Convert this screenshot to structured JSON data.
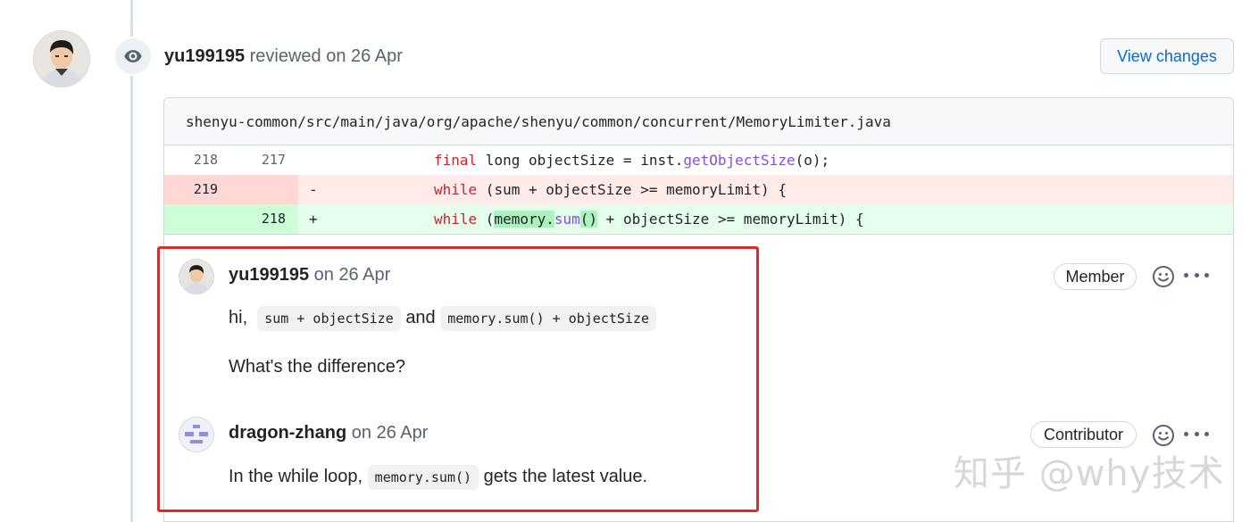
{
  "review": {
    "author": "yu199195",
    "action": " reviewed on 26 Apr",
    "view_changes_label": "View changes"
  },
  "file": {
    "path": "shenyu-common/src/main/java/org/apache/shenyu/common/concurrent/MemoryLimiter.java"
  },
  "diff": [
    {
      "old": "218",
      "new": "217",
      "sign": "",
      "kw": "final",
      "rest": " long objectSize = inst.",
      "fn": "getObjectSize",
      "tail": "(o);"
    },
    {
      "old": "219",
      "new": "",
      "sign": "-",
      "kw": "while",
      "rest": " (sum + objectSize >= memoryLimit) {"
    },
    {
      "old": "",
      "new": "218",
      "sign": "+",
      "kw": "while",
      "p1": " (",
      "hl1": "memory.",
      "fn": "sum",
      "hl2": "()",
      "tail": " + objectSize >= memoryLimit) {"
    }
  ],
  "comments": [
    {
      "author": "yu199195",
      "date": " on 26 Apr",
      "role": "Member",
      "text_hi": "hi,",
      "code1": "sum + objectSize",
      "text_and": "and",
      "code2": "memory.sum() + objectSize",
      "question": "What's the difference?"
    },
    {
      "author": "dragon-zhang",
      "date": " on 26 Apr",
      "role": "Contributor",
      "text_pre": "In the while loop,",
      "code": "memory.sum()",
      "text_post": "gets the latest value."
    }
  ],
  "watermark": "知乎 @why技术",
  "icons": {
    "eye": "eye-icon",
    "emoji": "smiley-icon",
    "more": "kebab-horizontal-icon"
  },
  "colors": {
    "link": "#0969da",
    "deletion_bg": "#ffebe9",
    "addition_bg": "#e6ffec",
    "highlight_box": "#d32f2f"
  }
}
